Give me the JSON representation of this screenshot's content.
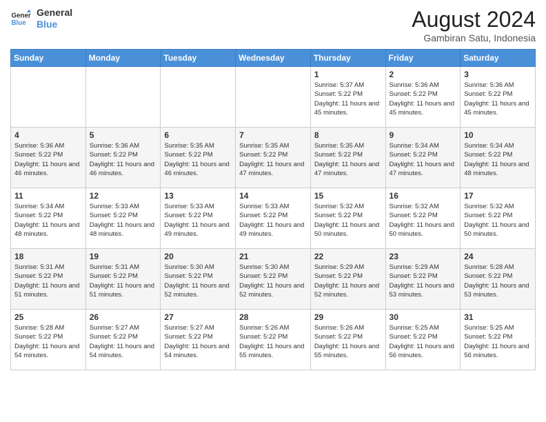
{
  "logo": {
    "line1": "General",
    "line2": "Blue"
  },
  "header": {
    "month_year": "August 2024",
    "location": "Gambiran Satu, Indonesia"
  },
  "weekdays": [
    "Sunday",
    "Monday",
    "Tuesday",
    "Wednesday",
    "Thursday",
    "Friday",
    "Saturday"
  ],
  "weeks": [
    [
      {
        "day": "",
        "info": ""
      },
      {
        "day": "",
        "info": ""
      },
      {
        "day": "",
        "info": ""
      },
      {
        "day": "",
        "info": ""
      },
      {
        "day": "1",
        "info": "Sunrise: 5:37 AM\nSunset: 5:22 PM\nDaylight: 11 hours\nand 45 minutes."
      },
      {
        "day": "2",
        "info": "Sunrise: 5:36 AM\nSunset: 5:22 PM\nDaylight: 11 hours\nand 45 minutes."
      },
      {
        "day": "3",
        "info": "Sunrise: 5:36 AM\nSunset: 5:22 PM\nDaylight: 11 hours\nand 45 minutes."
      }
    ],
    [
      {
        "day": "4",
        "info": "Sunrise: 5:36 AM\nSunset: 5:22 PM\nDaylight: 11 hours\nand 46 minutes."
      },
      {
        "day": "5",
        "info": "Sunrise: 5:36 AM\nSunset: 5:22 PM\nDaylight: 11 hours\nand 46 minutes."
      },
      {
        "day": "6",
        "info": "Sunrise: 5:35 AM\nSunset: 5:22 PM\nDaylight: 11 hours\nand 46 minutes."
      },
      {
        "day": "7",
        "info": "Sunrise: 5:35 AM\nSunset: 5:22 PM\nDaylight: 11 hours\nand 47 minutes."
      },
      {
        "day": "8",
        "info": "Sunrise: 5:35 AM\nSunset: 5:22 PM\nDaylight: 11 hours\nand 47 minutes."
      },
      {
        "day": "9",
        "info": "Sunrise: 5:34 AM\nSunset: 5:22 PM\nDaylight: 11 hours\nand 47 minutes."
      },
      {
        "day": "10",
        "info": "Sunrise: 5:34 AM\nSunset: 5:22 PM\nDaylight: 11 hours\nand 48 minutes."
      }
    ],
    [
      {
        "day": "11",
        "info": "Sunrise: 5:34 AM\nSunset: 5:22 PM\nDaylight: 11 hours\nand 48 minutes."
      },
      {
        "day": "12",
        "info": "Sunrise: 5:33 AM\nSunset: 5:22 PM\nDaylight: 11 hours\nand 48 minutes."
      },
      {
        "day": "13",
        "info": "Sunrise: 5:33 AM\nSunset: 5:22 PM\nDaylight: 11 hours\nand 49 minutes."
      },
      {
        "day": "14",
        "info": "Sunrise: 5:33 AM\nSunset: 5:22 PM\nDaylight: 11 hours\nand 49 minutes."
      },
      {
        "day": "15",
        "info": "Sunrise: 5:32 AM\nSunset: 5:22 PM\nDaylight: 11 hours\nand 50 minutes."
      },
      {
        "day": "16",
        "info": "Sunrise: 5:32 AM\nSunset: 5:22 PM\nDaylight: 11 hours\nand 50 minutes."
      },
      {
        "day": "17",
        "info": "Sunrise: 5:32 AM\nSunset: 5:22 PM\nDaylight: 11 hours\nand 50 minutes."
      }
    ],
    [
      {
        "day": "18",
        "info": "Sunrise: 5:31 AM\nSunset: 5:22 PM\nDaylight: 11 hours\nand 51 minutes."
      },
      {
        "day": "19",
        "info": "Sunrise: 5:31 AM\nSunset: 5:22 PM\nDaylight: 11 hours\nand 51 minutes."
      },
      {
        "day": "20",
        "info": "Sunrise: 5:30 AM\nSunset: 5:22 PM\nDaylight: 11 hours\nand 52 minutes."
      },
      {
        "day": "21",
        "info": "Sunrise: 5:30 AM\nSunset: 5:22 PM\nDaylight: 11 hours\nand 52 minutes."
      },
      {
        "day": "22",
        "info": "Sunrise: 5:29 AM\nSunset: 5:22 PM\nDaylight: 11 hours\nand 52 minutes."
      },
      {
        "day": "23",
        "info": "Sunrise: 5:29 AM\nSunset: 5:22 PM\nDaylight: 11 hours\nand 53 minutes."
      },
      {
        "day": "24",
        "info": "Sunrise: 5:28 AM\nSunset: 5:22 PM\nDaylight: 11 hours\nand 53 minutes."
      }
    ],
    [
      {
        "day": "25",
        "info": "Sunrise: 5:28 AM\nSunset: 5:22 PM\nDaylight: 11 hours\nand 54 minutes."
      },
      {
        "day": "26",
        "info": "Sunrise: 5:27 AM\nSunset: 5:22 PM\nDaylight: 11 hours\nand 54 minutes."
      },
      {
        "day": "27",
        "info": "Sunrise: 5:27 AM\nSunset: 5:22 PM\nDaylight: 11 hours\nand 54 minutes."
      },
      {
        "day": "28",
        "info": "Sunrise: 5:26 AM\nSunset: 5:22 PM\nDaylight: 11 hours\nand 55 minutes."
      },
      {
        "day": "29",
        "info": "Sunrise: 5:26 AM\nSunset: 5:22 PM\nDaylight: 11 hours\nand 55 minutes."
      },
      {
        "day": "30",
        "info": "Sunrise: 5:25 AM\nSunset: 5:22 PM\nDaylight: 11 hours\nand 56 minutes."
      },
      {
        "day": "31",
        "info": "Sunrise: 5:25 AM\nSunset: 5:22 PM\nDaylight: 11 hours\nand 56 minutes."
      }
    ]
  ]
}
